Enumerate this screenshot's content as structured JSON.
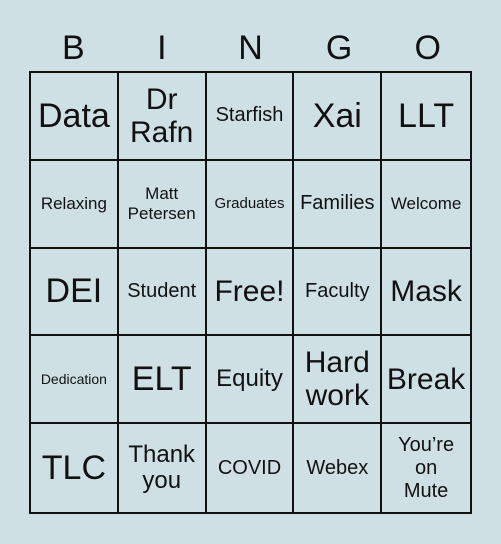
{
  "header": {
    "letters": [
      "B",
      "I",
      "N",
      "G",
      "O"
    ]
  },
  "board": {
    "rows": [
      [
        "Data",
        "Dr Rafn",
        "Starfish",
        "Xai",
        "LLT"
      ],
      [
        "Relaxing",
        "Matt Petersen",
        "Graduates",
        "Families",
        "Welcome"
      ],
      [
        "DEI",
        "Student",
        "Free!",
        "Faculty",
        "Mask"
      ],
      [
        "Dedication",
        "ELT",
        "Equity",
        "Hard work",
        "Break"
      ],
      [
        "TLC",
        "Thank you",
        "COVID",
        "Webex",
        "You’re on Mute"
      ]
    ],
    "display_lines": [
      [
        [
          "Data"
        ],
        [
          "Dr",
          "Rafn"
        ],
        [
          "Starfish"
        ],
        [
          "Xai"
        ],
        [
          "LLT"
        ]
      ],
      [
        [
          "Relaxing"
        ],
        [
          "Matt",
          "Petersen"
        ],
        [
          "Graduates"
        ],
        [
          "Families"
        ],
        [
          "Welcome"
        ]
      ],
      [
        [
          "DEI"
        ],
        [
          "Student"
        ],
        [
          "Free!"
        ],
        [
          "Faculty"
        ],
        [
          "Mask"
        ]
      ],
      [
        [
          "Dedication"
        ],
        [
          "ELT"
        ],
        [
          "Equity"
        ],
        [
          "Hard",
          "work"
        ],
        [
          "Break"
        ]
      ],
      [
        [
          "TLC"
        ],
        [
          "Thank",
          "you"
        ],
        [
          "COVID"
        ],
        [
          "Webex"
        ],
        [
          "You’re",
          "on",
          "Mute"
        ]
      ]
    ]
  },
  "colors": {
    "background": "#cfe0e5",
    "grid_line": "#111111",
    "text": "#111111"
  }
}
